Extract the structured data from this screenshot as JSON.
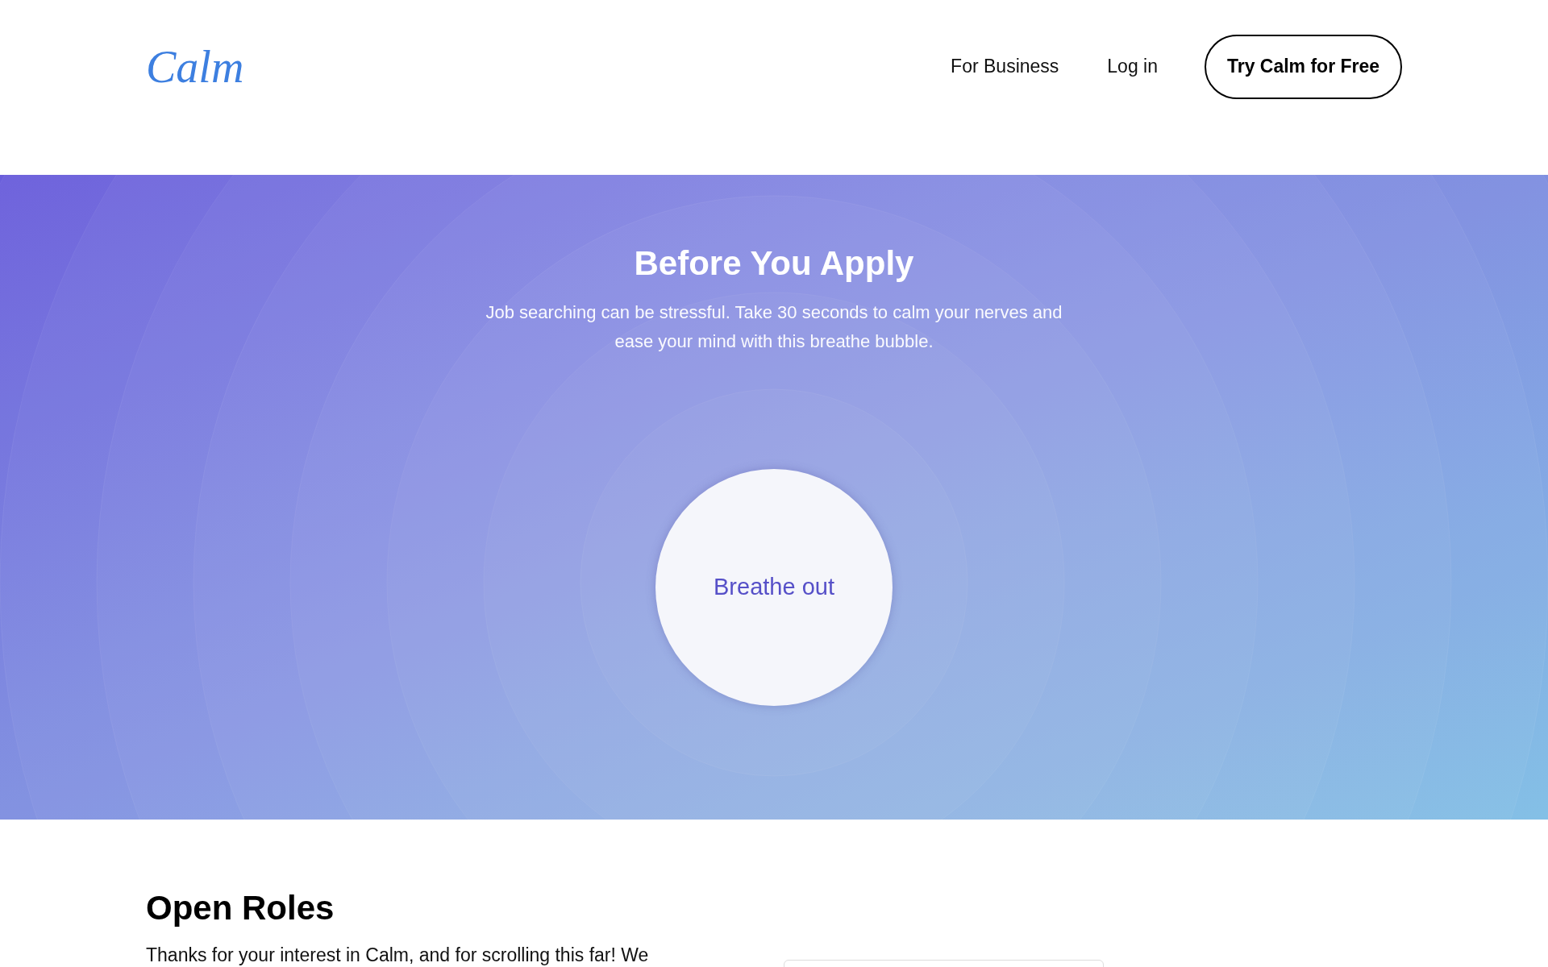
{
  "header": {
    "logo": "Calm",
    "nav": [
      "For Business",
      "Log in"
    ],
    "cta": "Try Calm for Free"
  },
  "hero": {
    "title": "Before You Apply",
    "subtitle": "Job searching can be stressful. Take 30 seconds to calm your nerves and ease your mind with this breathe bubble.",
    "bubble": "Breathe out"
  },
  "open_roles": {
    "title": "Open Roles",
    "intro": "Thanks for your interest in Calm, and for scrolling this far! We"
  }
}
